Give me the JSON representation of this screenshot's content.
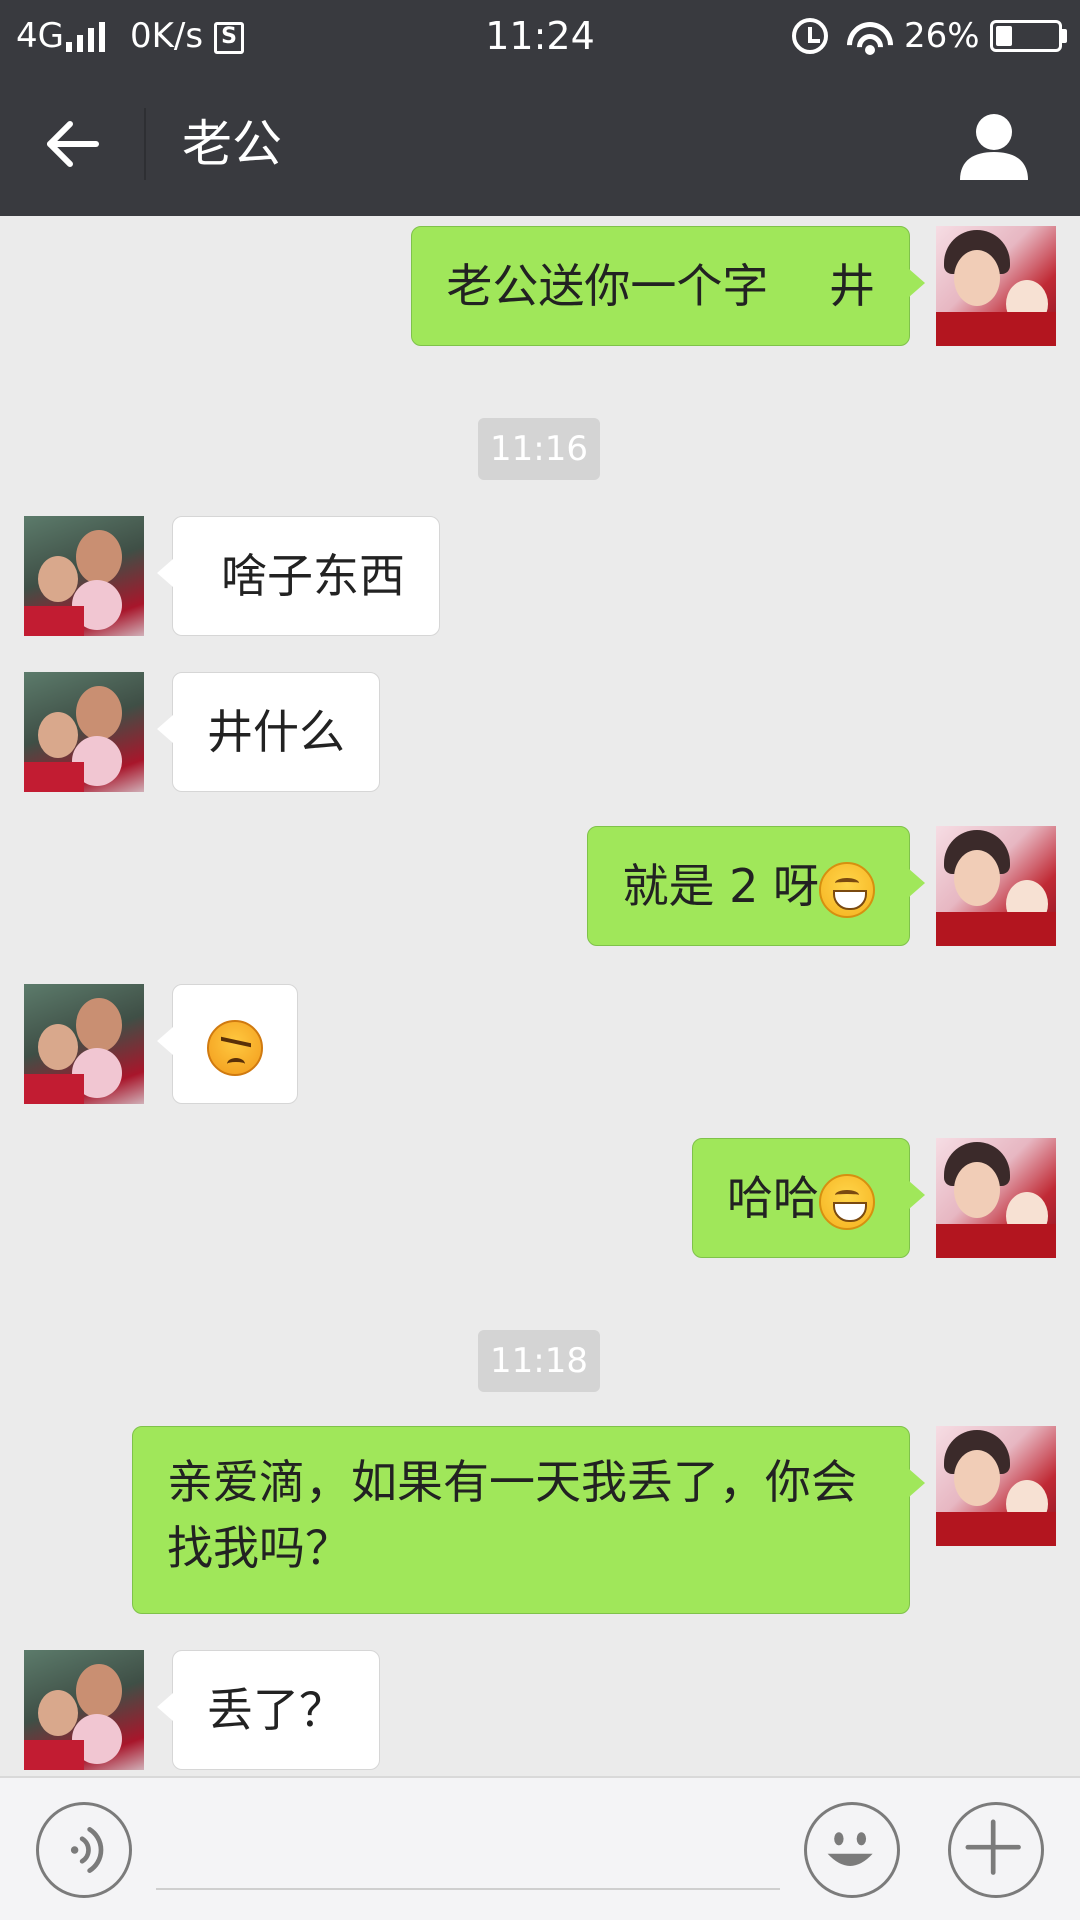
{
  "status_bar": {
    "network": "4G",
    "speed": "0K/s",
    "s_icon": "S",
    "time": "11:24",
    "battery": "26%",
    "battery_level": 0.26,
    "icons": [
      "signal-icon",
      "s-app-icon",
      "alarm-icon",
      "wifi-icon",
      "battery-icon"
    ]
  },
  "header": {
    "title": "老公",
    "back_icon": "back-arrow-icon",
    "profile_icon": "person-icon"
  },
  "messages": [
    {
      "sender": "me",
      "text": "老公送你一个字　 井"
    },
    {
      "type": "timestamp",
      "text": "11:16"
    },
    {
      "sender": "other",
      "text": "啥子东西"
    },
    {
      "sender": "other",
      "text": "井什么"
    },
    {
      "sender": "me",
      "text": "就是 2 呀",
      "emoji": "grinning-emoji"
    },
    {
      "sender": "other",
      "text": "",
      "emoji": "angry-emoji"
    },
    {
      "sender": "me",
      "text": "哈哈",
      "emoji": "grinning-emoji"
    },
    {
      "type": "timestamp",
      "text": "11:18"
    },
    {
      "sender": "me",
      "text": "亲爱滴，如果有一天我丢了，你会找我吗？"
    },
    {
      "sender": "other",
      "text": "丢了？"
    }
  ],
  "input_bar": {
    "placeholder": "",
    "voice_icon": "voice-icon",
    "emoji_icon": "smiley-icon",
    "plus_icon": "plus-icon"
  },
  "colors": {
    "bar_bg": "#393a3f",
    "chat_bg": "#ebebeb",
    "my_bubble": "#a0e75a",
    "other_bubble": "#ffffff"
  }
}
